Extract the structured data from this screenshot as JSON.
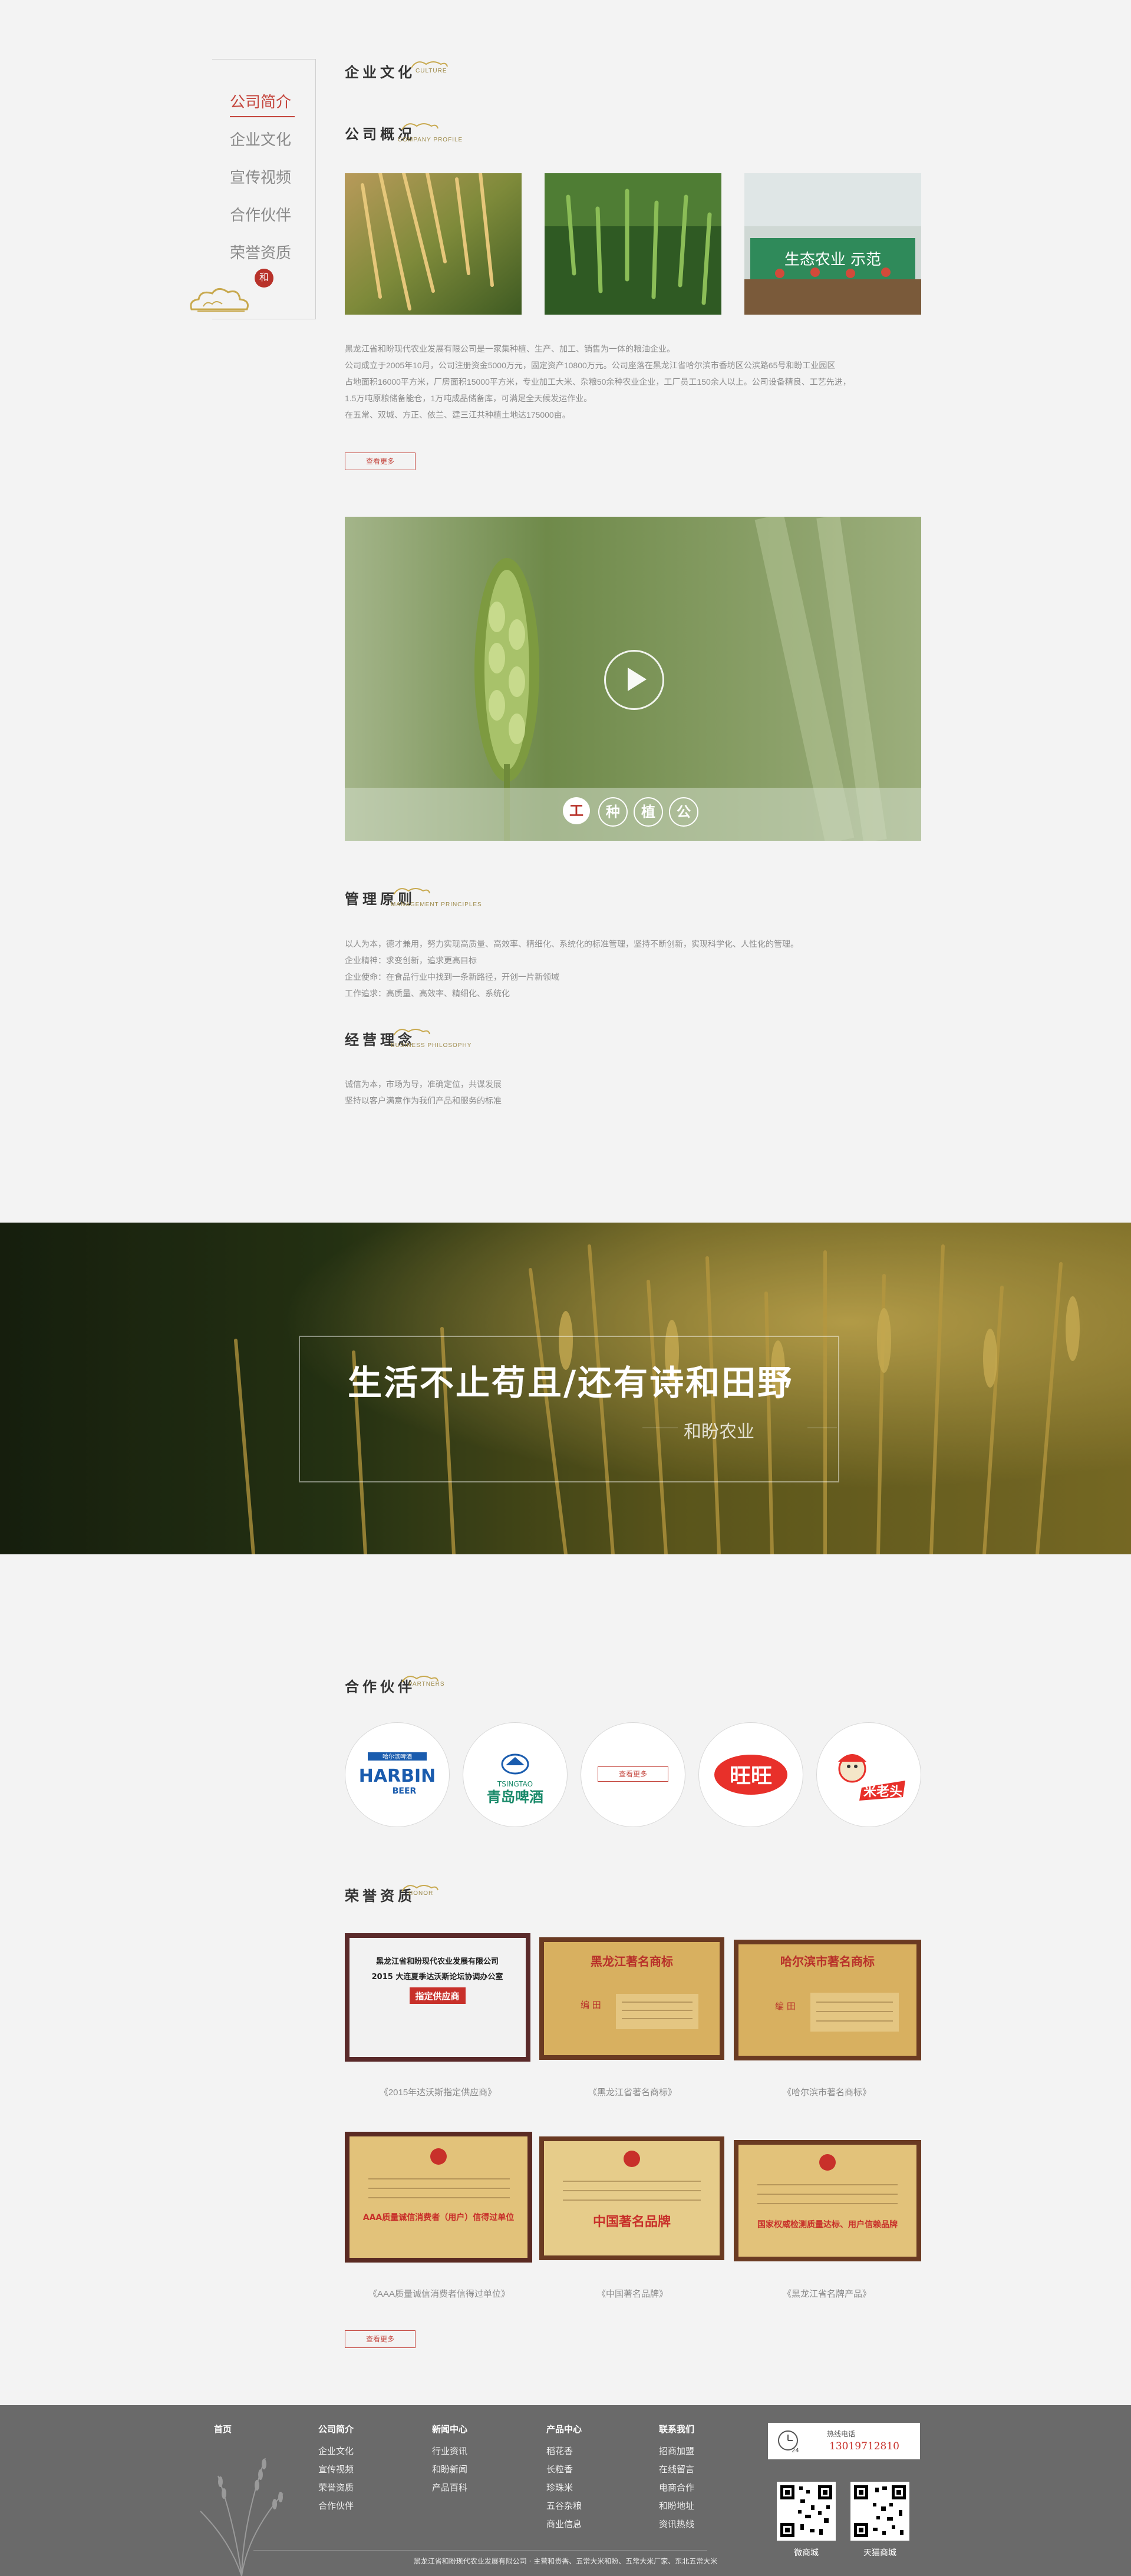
{
  "sidebar": {
    "items": [
      {
        "label": "公司简介",
        "active": true
      },
      {
        "label": "企业文化",
        "active": false
      },
      {
        "label": "宣传视频",
        "active": false
      },
      {
        "label": "合作伙伴",
        "active": false
      },
      {
        "label": "荣誉资质",
        "active": false
      }
    ],
    "seal_char": "和"
  },
  "culture": {
    "heading": "企业文化",
    "heading_en": "CULTURE"
  },
  "profile": {
    "heading": "公司概况",
    "heading_en": "COMPANY PROFILE",
    "paragraphs": [
      "黑龙江省和盼现代农业发展有限公司是一家集种植、生产、加工、销售为一体的粮油企业。",
      "公司成立于2005年10月，公司注册资金5000万元，固定资产10800万元。公司座落在黑龙江省哈尔滨市香坊区公滨路65号和盼工业园区",
      "占地面积16000平方米，厂房面积15000平方米，专业加工大米、杂粮50余种农业企业，工厂员工150余人以上。公司设备精良、工艺先进，",
      "1.5万吨原粮储备能仓，1万吨成品储备库，可满足全天候发运作业。",
      "在五常、双城、方正、依兰、建三江共种植土地达175000亩。"
    ],
    "more_label": "查看更多"
  },
  "video": {
    "craft_chars": [
      "工",
      "种",
      "植",
      "公"
    ]
  },
  "management": {
    "heading": "管理原则",
    "heading_en": "MANAGEMENT PRINCIPLES",
    "lines": [
      "以人为本，德才兼用，努力实现高质量、高效率、精细化、系统化的标准管理，坚持不断创新，实现科学化、人性化的管理。",
      "企业精神：求变创新，追求更高目标",
      "企业使命：在食品行业中找到一条新路径，开创一片新领域",
      "工作追求：高质量、高效率、精细化、系统化"
    ]
  },
  "philosophy": {
    "heading": "经营理念",
    "heading_en": "BUSINESS PHILOSOPHY",
    "lines": [
      "诚信为本，市场为导，准确定位，共谋发展",
      "坚持以客户满意作为我们产品和服务的标准"
    ]
  },
  "banner": {
    "title": "生活不止苟且/还有诗和田野",
    "subtitle": "和盼农业"
  },
  "partners": {
    "heading": "合作伙伴",
    "heading_en": "PARTNERS",
    "logos": [
      {
        "name": "HARBIN",
        "sub": "BEER",
        "cn": "哈尔滨啤酒"
      },
      {
        "name": "TSINGTAO",
        "cn": "青岛啤酒"
      },
      {
        "more_label": "查看更多"
      },
      {
        "name": "旺旺"
      },
      {
        "name": "米老头"
      }
    ]
  },
  "honors": {
    "heading": "荣誉资质",
    "heading_en": "HONOR",
    "certs": [
      {
        "caption": "《2015年达沃斯指定供应商》",
        "lines": [
          "黑龙江省和盼现代农业发展有限公司",
          "2015 大连夏季达沃斯论坛协调办公室",
          "指定供应商"
        ]
      },
      {
        "caption": "《黑龙江省著名商标》",
        "lines": [
          "黑龙江著名商标",
          "编 田"
        ]
      },
      {
        "caption": "《哈尔滨市著名商标》",
        "lines": [
          "哈尔滨市著名商标",
          "编 田"
        ]
      },
      {
        "caption": "《AAA质量诚信消费者信得过单位》",
        "lines": [
          "AAA质量诚信消费者（用户）信得过单位"
        ]
      },
      {
        "caption": "《中国著名品牌》",
        "lines": [
          "中国著名品牌"
        ]
      },
      {
        "caption": "《黑龙江省名牌产品》",
        "lines": [
          "国家权威检测质量达标、用户信赖品牌"
        ]
      }
    ],
    "more_label": "查看更多"
  },
  "footer": {
    "home": "首页",
    "columns": [
      {
        "title": "公司简介",
        "items": [
          "企业文化",
          "宣传视频",
          "荣誉资质",
          "合作伙伴"
        ]
      },
      {
        "title": "新闻中心",
        "items": [
          "行业资讯",
          "和盼新闻",
          "产品百科"
        ]
      },
      {
        "title": "产品中心",
        "items": [
          "稻花香",
          "长粒香",
          "珍珠米",
          "五谷杂粮",
          "商业信息"
        ]
      },
      {
        "title": "联系我们",
        "items": [
          "招商加盟",
          "在线留言",
          "电商合作",
          "和盼地址",
          "资讯热线"
        ]
      }
    ],
    "hotline_label": "热线电话",
    "hotline_number": "13019712810",
    "qr": [
      {
        "caption": "微商城"
      },
      {
        "caption": "天猫商城"
      }
    ],
    "copyright": "黑龙江省和盼现代农业发展有限公司  · 主营和贵香、五常大米和盼、五常大米厂家、东北五常大米"
  }
}
